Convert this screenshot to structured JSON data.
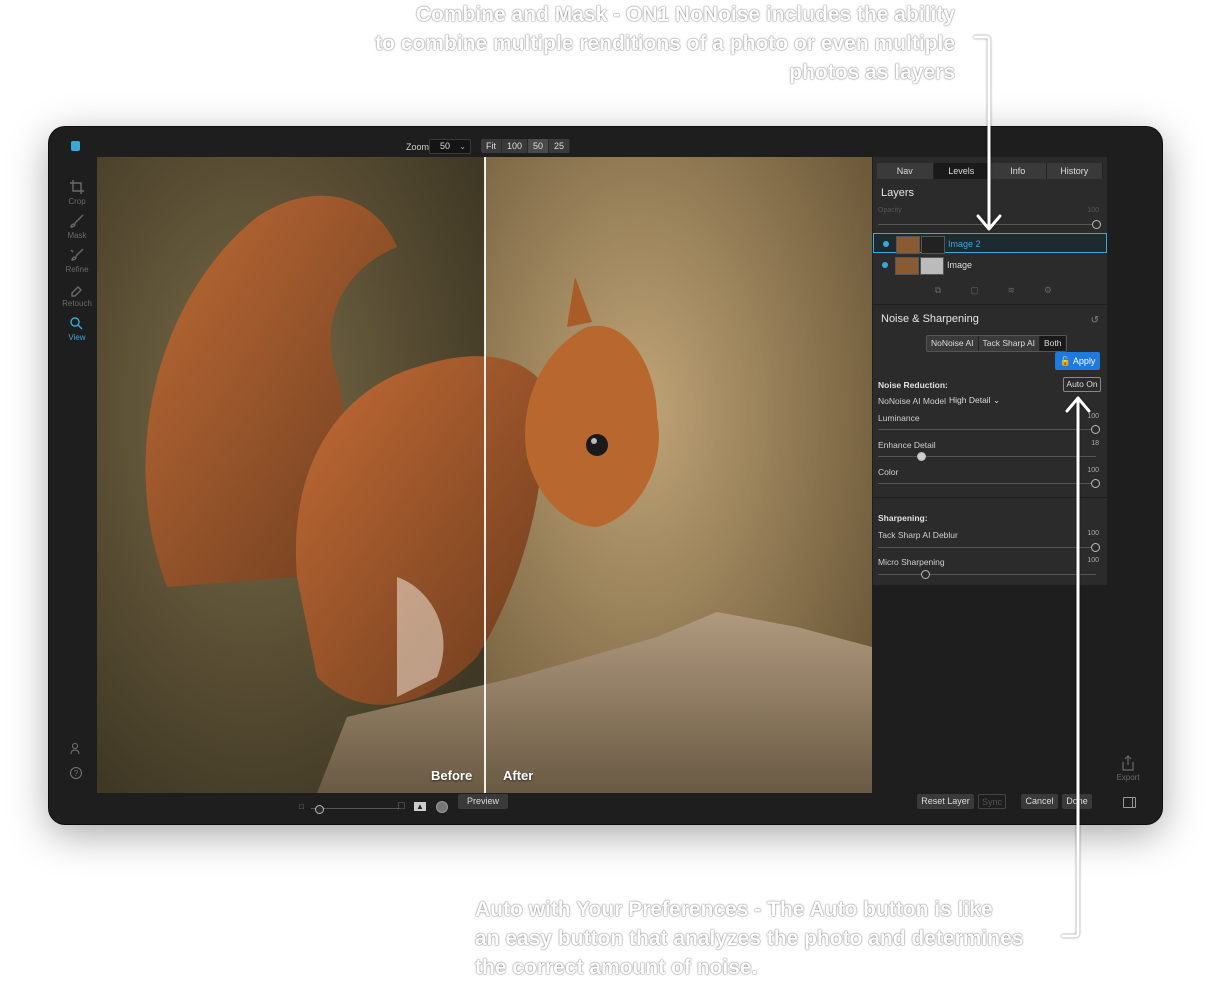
{
  "callouts": {
    "top_line1": "Combine and Mask - ON1 NoNoise includes the ability",
    "top_line2": "to combine multiple renditions of a photo or even multiple",
    "top_line3": "photos as layers",
    "bottom_line1": "Auto with Your Preferences - The Auto button is like",
    "bottom_line2": "an easy button that analyzes the photo and determines",
    "bottom_line3": "the correct amount of noise."
  },
  "toolbar": {
    "zoom_label": "Zoom",
    "zoom_value": "50",
    "zoom_buttons": [
      "Fit",
      "100",
      "50",
      "25"
    ]
  },
  "tools": {
    "crop": "Crop",
    "mask": "Mask",
    "refine": "Refine",
    "retouch": "Retouch",
    "view": "View"
  },
  "canvas": {
    "before_label": "Before",
    "after_label": "After",
    "split_position": 0.5
  },
  "panel": {
    "tabs": [
      "Nav",
      "Levels",
      "Info",
      "History"
    ],
    "active_tab": "Levels",
    "layers_title": "Layers",
    "opacity_label": "Opacity",
    "opacity_value": "100",
    "layers": [
      {
        "name": "Image 2",
        "selected": true
      },
      {
        "name": "Image",
        "selected": false
      }
    ],
    "noise_title": "Noise & Sharpening",
    "modes": [
      "NoNoise AI",
      "Tack Sharp AI",
      "Both"
    ],
    "active_mode": "Both",
    "apply_label": "Apply",
    "noise_reduction_label": "Noise Reduction:",
    "auto_label": "Auto On",
    "model_label": "NoNoise AI Model",
    "model_value": "High Detail",
    "sliders": {
      "luminance": {
        "label": "Luminance",
        "value": "100"
      },
      "enhance_detail": {
        "label": "Enhance Detail",
        "value": "18"
      },
      "color": {
        "label": "Color",
        "value": "100"
      },
      "tack_sharp": {
        "label": "Tack Sharp AI Deblur",
        "value": "100"
      },
      "micro_sharpening": {
        "label": "Micro Sharpening",
        "value": "100"
      }
    },
    "sharpening_label": "Sharpening:"
  },
  "bottombar": {
    "preview_label": "Preview",
    "reset_layer_label": "Reset Layer",
    "sync_label": "Sync",
    "cancel_label": "Cancel",
    "done_label": "Done",
    "export_label": "Export"
  },
  "colors": {
    "accent": "#3aa9d8",
    "apply_blue": "#1f7ae0",
    "window_bg": "#1e1e1e",
    "panel_bg": "#2b2b2b"
  }
}
